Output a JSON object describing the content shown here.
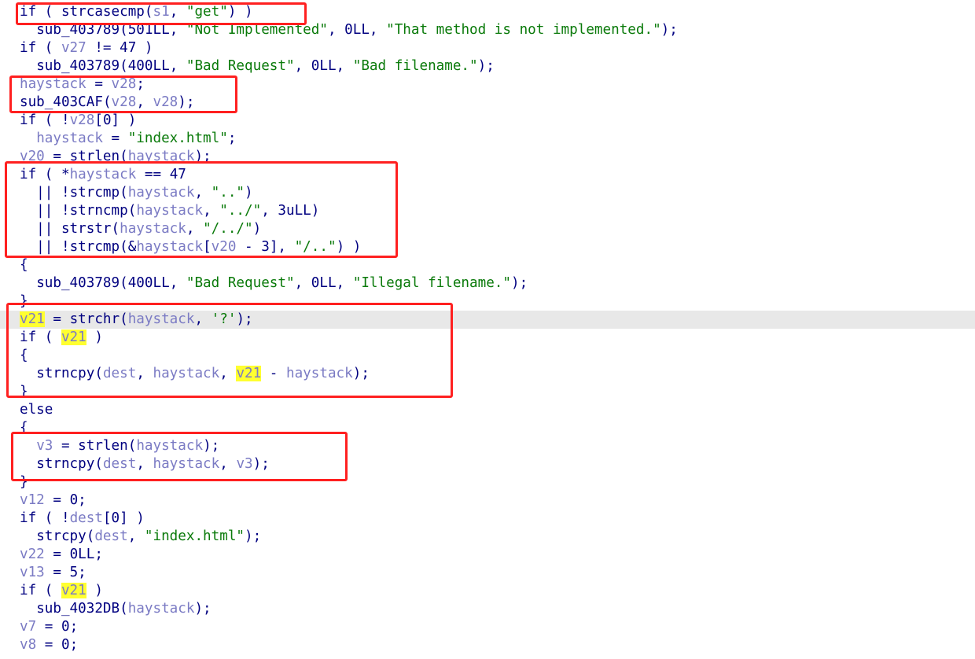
{
  "colors": {
    "background": "#ffffff",
    "keyword": "#000080",
    "variable": "#7b7bc4",
    "string": "#0a7a0a",
    "highlight_word": "#ffff30",
    "current_line": "#e8e8e8",
    "annotation_box": "#ff2020"
  },
  "highlight_line_index": 17,
  "lines": [
    {
      "t": [
        {
          "c": "kw",
          "s": "if ( "
        },
        {
          "c": "fn",
          "s": "strcasecmp"
        },
        {
          "c": "op",
          "s": "("
        },
        {
          "c": "var",
          "s": "s1"
        },
        {
          "c": "op",
          "s": ", "
        },
        {
          "c": "str",
          "s": "\"get\""
        },
        {
          "c": "op",
          "s": ") )"
        }
      ]
    },
    {
      "t": [
        {
          "c": "op",
          "s": "  "
        },
        {
          "c": "fn",
          "s": "sub_403789"
        },
        {
          "c": "op",
          "s": "("
        },
        {
          "c": "num",
          "s": "501LL"
        },
        {
          "c": "op",
          "s": ", "
        },
        {
          "c": "str",
          "s": "\"Not Implemented\""
        },
        {
          "c": "op",
          "s": ", "
        },
        {
          "c": "num",
          "s": "0LL"
        },
        {
          "c": "op",
          "s": ", "
        },
        {
          "c": "str",
          "s": "\"That method is not implemented.\""
        },
        {
          "c": "op",
          "s": ");"
        }
      ]
    },
    {
      "t": [
        {
          "c": "kw",
          "s": "if ( "
        },
        {
          "c": "var",
          "s": "v27"
        },
        {
          "c": "op",
          "s": " != "
        },
        {
          "c": "num",
          "s": "47"
        },
        {
          "c": "op",
          "s": " )"
        }
      ]
    },
    {
      "t": [
        {
          "c": "op",
          "s": "  "
        },
        {
          "c": "fn",
          "s": "sub_403789"
        },
        {
          "c": "op",
          "s": "("
        },
        {
          "c": "num",
          "s": "400LL"
        },
        {
          "c": "op",
          "s": ", "
        },
        {
          "c": "str",
          "s": "\"Bad Request\""
        },
        {
          "c": "op",
          "s": ", "
        },
        {
          "c": "num",
          "s": "0LL"
        },
        {
          "c": "op",
          "s": ", "
        },
        {
          "c": "str",
          "s": "\"Bad filename.\""
        },
        {
          "c": "op",
          "s": ");"
        }
      ]
    },
    {
      "t": [
        {
          "c": "var",
          "s": "haystack"
        },
        {
          "c": "op",
          "s": " = "
        },
        {
          "c": "var",
          "s": "v28"
        },
        {
          "c": "op",
          "s": ";"
        }
      ]
    },
    {
      "t": [
        {
          "c": "fn",
          "s": "sub_403CAF"
        },
        {
          "c": "op",
          "s": "("
        },
        {
          "c": "var",
          "s": "v28"
        },
        {
          "c": "op",
          "s": ", "
        },
        {
          "c": "var",
          "s": "v28"
        },
        {
          "c": "op",
          "s": ");"
        }
      ]
    },
    {
      "t": [
        {
          "c": "kw",
          "s": "if ( "
        },
        {
          "c": "op",
          "s": "!"
        },
        {
          "c": "var",
          "s": "v28"
        },
        {
          "c": "op",
          "s": "["
        },
        {
          "c": "num",
          "s": "0"
        },
        {
          "c": "op",
          "s": "] )"
        }
      ]
    },
    {
      "t": [
        {
          "c": "op",
          "s": "  "
        },
        {
          "c": "var",
          "s": "haystack"
        },
        {
          "c": "op",
          "s": " = "
        },
        {
          "c": "str",
          "s": "\"index.html\""
        },
        {
          "c": "op",
          "s": ";"
        }
      ]
    },
    {
      "t": [
        {
          "c": "var",
          "s": "v20"
        },
        {
          "c": "op",
          "s": " = "
        },
        {
          "c": "fn",
          "s": "strlen"
        },
        {
          "c": "op",
          "s": "("
        },
        {
          "c": "var",
          "s": "haystack"
        },
        {
          "c": "op",
          "s": ");"
        }
      ]
    },
    {
      "t": [
        {
          "c": "kw",
          "s": "if ( "
        },
        {
          "c": "op",
          "s": "*"
        },
        {
          "c": "var",
          "s": "haystack"
        },
        {
          "c": "op",
          "s": " == "
        },
        {
          "c": "num",
          "s": "47"
        }
      ]
    },
    {
      "t": [
        {
          "c": "op",
          "s": "  || !"
        },
        {
          "c": "fn",
          "s": "strcmp"
        },
        {
          "c": "op",
          "s": "("
        },
        {
          "c": "var",
          "s": "haystack"
        },
        {
          "c": "op",
          "s": ", "
        },
        {
          "c": "str",
          "s": "\"..\""
        },
        {
          "c": "op",
          "s": ")"
        }
      ]
    },
    {
      "t": [
        {
          "c": "op",
          "s": "  || !"
        },
        {
          "c": "fn",
          "s": "strncmp"
        },
        {
          "c": "op",
          "s": "("
        },
        {
          "c": "var",
          "s": "haystack"
        },
        {
          "c": "op",
          "s": ", "
        },
        {
          "c": "str",
          "s": "\"../\""
        },
        {
          "c": "op",
          "s": ", "
        },
        {
          "c": "num",
          "s": "3uLL"
        },
        {
          "c": "op",
          "s": ")"
        }
      ]
    },
    {
      "t": [
        {
          "c": "op",
          "s": "  || "
        },
        {
          "c": "fn",
          "s": "strstr"
        },
        {
          "c": "op",
          "s": "("
        },
        {
          "c": "var",
          "s": "haystack"
        },
        {
          "c": "op",
          "s": ", "
        },
        {
          "c": "str",
          "s": "\"/../\""
        },
        {
          "c": "op",
          "s": ")"
        }
      ]
    },
    {
      "t": [
        {
          "c": "op",
          "s": "  || !"
        },
        {
          "c": "fn",
          "s": "strcmp"
        },
        {
          "c": "op",
          "s": "(&"
        },
        {
          "c": "var",
          "s": "haystack"
        },
        {
          "c": "op",
          "s": "["
        },
        {
          "c": "var",
          "s": "v20"
        },
        {
          "c": "op",
          "s": " - "
        },
        {
          "c": "num",
          "s": "3"
        },
        {
          "c": "op",
          "s": "], "
        },
        {
          "c": "str",
          "s": "\"/..\""
        },
        {
          "c": "op",
          "s": ") )"
        }
      ]
    },
    {
      "t": [
        {
          "c": "op",
          "s": "{"
        }
      ]
    },
    {
      "t": [
        {
          "c": "op",
          "s": "  "
        },
        {
          "c": "fn",
          "s": "sub_403789"
        },
        {
          "c": "op",
          "s": "("
        },
        {
          "c": "num",
          "s": "400LL"
        },
        {
          "c": "op",
          "s": ", "
        },
        {
          "c": "str",
          "s": "\"Bad Request\""
        },
        {
          "c": "op",
          "s": ", "
        },
        {
          "c": "num",
          "s": "0LL"
        },
        {
          "c": "op",
          "s": ", "
        },
        {
          "c": "str",
          "s": "\"Illegal filename.\""
        },
        {
          "c": "op",
          "s": ");"
        }
      ]
    },
    {
      "t": [
        {
          "c": "op",
          "s": "}"
        }
      ]
    },
    {
      "t": [
        {
          "c": "var",
          "s": "v21",
          "y": true
        },
        {
          "c": "op",
          "s": " = "
        },
        {
          "c": "fn",
          "s": "strchr"
        },
        {
          "c": "op",
          "s": "("
        },
        {
          "c": "var",
          "s": "haystack"
        },
        {
          "c": "op",
          "s": ", "
        },
        {
          "c": "str",
          "s": "'?'"
        },
        {
          "c": "op",
          "s": ");"
        }
      ]
    },
    {
      "t": [
        {
          "c": "kw",
          "s": "if ( "
        },
        {
          "c": "var",
          "s": "v21",
          "y": true
        },
        {
          "c": "op",
          "s": " )"
        }
      ]
    },
    {
      "t": [
        {
          "c": "op",
          "s": "{"
        }
      ]
    },
    {
      "t": [
        {
          "c": "op",
          "s": "  "
        },
        {
          "c": "fn",
          "s": "strncpy"
        },
        {
          "c": "op",
          "s": "("
        },
        {
          "c": "var",
          "s": "dest"
        },
        {
          "c": "op",
          "s": ", "
        },
        {
          "c": "var",
          "s": "haystack"
        },
        {
          "c": "op",
          "s": ", "
        },
        {
          "c": "var",
          "s": "v21",
          "y": true
        },
        {
          "c": "op",
          "s": " - "
        },
        {
          "c": "var",
          "s": "haystack"
        },
        {
          "c": "op",
          "s": ");"
        }
      ]
    },
    {
      "t": [
        {
          "c": "op",
          "s": "}"
        }
      ]
    },
    {
      "t": [
        {
          "c": "kw",
          "s": "else"
        }
      ]
    },
    {
      "t": [
        {
          "c": "op",
          "s": "{"
        }
      ]
    },
    {
      "t": [
        {
          "c": "op",
          "s": "  "
        },
        {
          "c": "var",
          "s": "v3"
        },
        {
          "c": "op",
          "s": " = "
        },
        {
          "c": "fn",
          "s": "strlen"
        },
        {
          "c": "op",
          "s": "("
        },
        {
          "c": "var",
          "s": "haystack"
        },
        {
          "c": "op",
          "s": ");"
        }
      ]
    },
    {
      "t": [
        {
          "c": "op",
          "s": "  "
        },
        {
          "c": "fn",
          "s": "strncpy"
        },
        {
          "c": "op",
          "s": "("
        },
        {
          "c": "var",
          "s": "dest"
        },
        {
          "c": "op",
          "s": ", "
        },
        {
          "c": "var",
          "s": "haystack"
        },
        {
          "c": "op",
          "s": ", "
        },
        {
          "c": "var",
          "s": "v3"
        },
        {
          "c": "op",
          "s": ");"
        }
      ]
    },
    {
      "t": [
        {
          "c": "op",
          "s": "}"
        }
      ]
    },
    {
      "t": [
        {
          "c": "var",
          "s": "v12"
        },
        {
          "c": "op",
          "s": " = "
        },
        {
          "c": "num",
          "s": "0"
        },
        {
          "c": "op",
          "s": ";"
        }
      ]
    },
    {
      "t": [
        {
          "c": "kw",
          "s": "if ( "
        },
        {
          "c": "op",
          "s": "!"
        },
        {
          "c": "var",
          "s": "dest"
        },
        {
          "c": "op",
          "s": "["
        },
        {
          "c": "num",
          "s": "0"
        },
        {
          "c": "op",
          "s": "] )"
        }
      ]
    },
    {
      "t": [
        {
          "c": "op",
          "s": "  "
        },
        {
          "c": "fn",
          "s": "strcpy"
        },
        {
          "c": "op",
          "s": "("
        },
        {
          "c": "var",
          "s": "dest"
        },
        {
          "c": "op",
          "s": ", "
        },
        {
          "c": "str",
          "s": "\"index.html\""
        },
        {
          "c": "op",
          "s": ");"
        }
      ]
    },
    {
      "t": [
        {
          "c": "var",
          "s": "v22"
        },
        {
          "c": "op",
          "s": " = "
        },
        {
          "c": "num",
          "s": "0LL"
        },
        {
          "c": "op",
          "s": ";"
        }
      ]
    },
    {
      "t": [
        {
          "c": "var",
          "s": "v13"
        },
        {
          "c": "op",
          "s": " = "
        },
        {
          "c": "num",
          "s": "5"
        },
        {
          "c": "op",
          "s": ";"
        }
      ]
    },
    {
      "t": [
        {
          "c": "kw",
          "s": "if ( "
        },
        {
          "c": "var",
          "s": "v21",
          "y": true
        },
        {
          "c": "op",
          "s": " )"
        }
      ]
    },
    {
      "t": [
        {
          "c": "op",
          "s": "  "
        },
        {
          "c": "fn",
          "s": "sub_4032DB"
        },
        {
          "c": "op",
          "s": "("
        },
        {
          "c": "var",
          "s": "haystack"
        },
        {
          "c": "op",
          "s": ");"
        }
      ]
    },
    {
      "t": [
        {
          "c": "var",
          "s": "v7"
        },
        {
          "c": "op",
          "s": " = "
        },
        {
          "c": "num",
          "s": "0"
        },
        {
          "c": "op",
          "s": ";"
        }
      ]
    },
    {
      "t": [
        {
          "c": "var",
          "s": "v8"
        },
        {
          "c": "op",
          "s": " = "
        },
        {
          "c": "num",
          "s": "0"
        },
        {
          "c": "op",
          "s": ";"
        }
      ]
    }
  ]
}
